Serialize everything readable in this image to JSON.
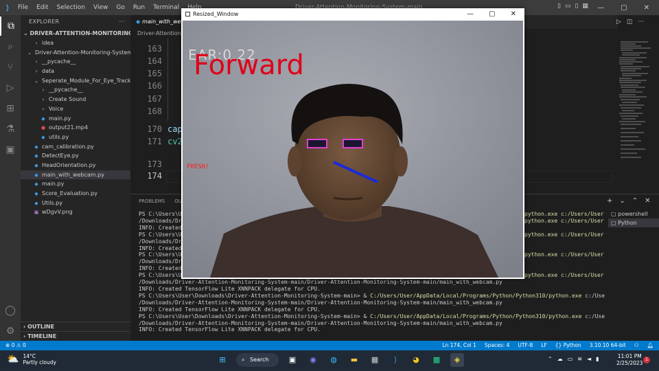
{
  "titlebar": {
    "menu": [
      "File",
      "Edit",
      "Selection",
      "View",
      "Go",
      "Run",
      "Terminal",
      "Help"
    ],
    "window_title": "Driver-Attention-Monitoring-System-main"
  },
  "explorer": {
    "header": "EXPLORER",
    "root": "DRIVER-ATTENTION-MONITORING-SYSTE...",
    "items": [
      {
        "label": "idea",
        "kind": "folder",
        "depth": 1
      },
      {
        "label": "Driver-Attention-Monitoring-System...",
        "kind": "folder-open",
        "depth": 0
      },
      {
        "label": "__pycache__",
        "kind": "folder",
        "depth": 1
      },
      {
        "label": "data",
        "kind": "folder",
        "depth": 1
      },
      {
        "label": "Seperate_Module_For_Eye_Tracking",
        "kind": "folder-open",
        "depth": 1
      },
      {
        "label": "__pycache__",
        "kind": "folder",
        "depth": 2
      },
      {
        "label": "Create Sound",
        "kind": "folder",
        "depth": 2
      },
      {
        "label": "Voice",
        "kind": "folder",
        "depth": 2
      },
      {
        "label": "main.py",
        "kind": "py",
        "depth": 2
      },
      {
        "label": "output21.mp4",
        "kind": "video",
        "depth": 2
      },
      {
        "label": "utils.py",
        "kind": "py",
        "depth": 2
      },
      {
        "label": "cam_calibration.py",
        "kind": "py",
        "depth": 1
      },
      {
        "label": "DetectEye.py",
        "kind": "py",
        "depth": 1
      },
      {
        "label": "HeadOrientation.py",
        "kind": "py",
        "depth": 1
      },
      {
        "label": "main_with_webcam.py",
        "kind": "py",
        "depth": 1,
        "selected": true
      },
      {
        "label": "main.py",
        "kind": "py",
        "depth": 1
      },
      {
        "label": "Score_Evaluation.py",
        "kind": "py",
        "depth": 1
      },
      {
        "label": "Utils.py",
        "kind": "py",
        "depth": 1
      },
      {
        "label": "wDgvV.png",
        "kind": "img",
        "depth": 1
      }
    ],
    "outline": "OUTLINE",
    "timeline": "TIMELINE"
  },
  "editor": {
    "tab": "main_with_web",
    "breadcrumb": "Driver-Attention-M",
    "lines": [
      {
        "n": "163",
        "text": ""
      },
      {
        "n": "164",
        "text": ""
      },
      {
        "n": "165",
        "text": ""
      },
      {
        "n": "166",
        "text": ""
      },
      {
        "n": "167",
        "text": ""
      },
      {
        "n": "168",
        "text": ""
      },
      {
        "n": "170",
        "text": "cap"
      },
      {
        "n": "171",
        "text": "cv2"
      },
      {
        "n": "173",
        "text": ""
      },
      {
        "n": "174",
        "text": ""
      }
    ]
  },
  "panel": {
    "tabs": [
      "PROBLEMS",
      "OUT"
    ],
    "terminals": [
      "powershell",
      "Python"
    ],
    "lines": [
      {
        "a": "PS C:\\Users\\U",
        "b": "",
        "c": "python.exe c:/Users/User"
      },
      {
        "a": "/Downloads/Dri",
        "b": "",
        "c": "python.exe c:/Users/User"
      },
      {
        "a": "INFO: Created",
        "b": "",
        "c": ""
      },
      {
        "a": "PS C:\\Users\\U",
        "b": "",
        "c": "python.exe c:/Users/User"
      },
      {
        "a": "/Downloads/Dri",
        "b": "",
        "c": ""
      },
      {
        "a": "INFO: Created",
        "b": "",
        "c": ""
      },
      {
        "a": "PS C:\\Users\\U",
        "b": "",
        "c": "python.exe c:/Users/User"
      },
      {
        "a": "/Downloads/Dri",
        "b": "",
        "c": ""
      },
      {
        "a": "INFO: Created",
        "b": "",
        "c": ""
      },
      {
        "a": "PS C:\\Users\\U",
        "b": "",
        "c": "python.exe c:/Users/User"
      },
      {
        "a": "/Downloads/Driver-Attention-Monitoring-System-main/Driver-Attention-Monitoring-System-main/main_with_webcam.py",
        "b": "",
        "c": ""
      },
      {
        "a": "INFO: Created TensorFlow Lite XNNPACK delegate for CPU.",
        "b": "",
        "c": ""
      },
      {
        "a": "PS C:\\Users\\User\\Downloads\\Driver-Attention-Monitoring-System-main> & ",
        "b": "C:/Users/User/AppData/Local/Programs/Python/Python310/python.exe",
        "c": " c:/Users/User"
      },
      {
        "a": "/Downloads/Driver-Attention-Monitoring-System-main/Driver-Attention-Monitoring-System-main/main_with_webcam.py",
        "b": "",
        "c": ""
      },
      {
        "a": "INFO: Created TensorFlow Lite XNNPACK delegate for CPU.",
        "b": "",
        "c": ""
      },
      {
        "a": "PS C:\\Users\\User\\Downloads\\Driver-Attention-Monitoring-System-main> & ",
        "b": "C:/Users/User/AppData/Local/Programs/Python/Python310/python.exe",
        "c": " c:/Users/User"
      },
      {
        "a": "/Downloads/Driver-Attention-Monitoring-System-main/Driver-Attention-Monitoring-System-main/main_with_webcam.py",
        "b": "",
        "c": ""
      },
      {
        "a": "INFO: Created TensorFlow Lite XNNPACK delegate for CPU.",
        "b": "",
        "c": ""
      }
    ]
  },
  "statusbar": {
    "errors": "0",
    "warnings": "0",
    "position": "Ln 174, Col 1",
    "spaces": "Spaces: 4",
    "encoding": "UTF-8",
    "eol": "LF",
    "language": "Python",
    "interpreter": "3.10.10 64-bit"
  },
  "cv_window": {
    "title": "Resized_Window",
    "ear_text": "EAR:0.22",
    "direction_text": "Forward",
    "state_text": "FRESH!"
  },
  "taskbar": {
    "temperature": "14°C",
    "condition": "Partly cloudy",
    "search": "Search",
    "time": "11:01 PM",
    "date": "2/25/2023",
    "notifications": "1"
  },
  "colors": {
    "accent": "#007acc",
    "direction_text": "#e0001a",
    "state_text": "#ff1a1a",
    "gaze_line": "#1a2bd8",
    "eye_box": "#e040d0"
  }
}
